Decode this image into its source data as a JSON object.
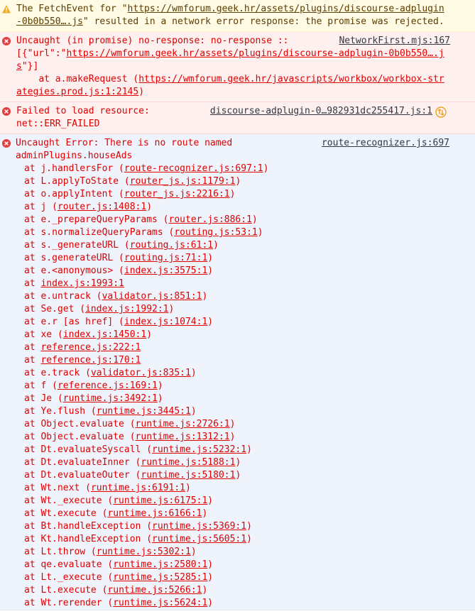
{
  "messages": [
    {
      "type": "warning",
      "icon": "warning-icon",
      "prefix": "The FetchEvent for \"",
      "link": "https://wmforum.geek.hr/assets/plugins/discourse-adplugin-0b0b550….js",
      "suffix": "\" resulted in a network error response: the promise was rejected."
    },
    {
      "type": "error",
      "icon": "error-icon",
      "source": "NetworkFirst.mjs:167",
      "line1": "Uncaught (in promise) no-response: no-response :: ",
      "line2_prefix": "[{\"url\":\"",
      "line2_link": "https://wmforum.geek.hr/assets/plugins/discourse-adplugin-0b0b550….js",
      "line2_suffix": "\"}]",
      "line3_prefix": "    at a.makeRequest (",
      "line3_link": "https://wmforum.geek.hr/javascripts/workbox/workbox-strategies.prod.js:1:2145",
      "line3_suffix": ")"
    },
    {
      "type": "error",
      "icon": "error-icon",
      "source": "discourse-adplugin-0…982931dc255417.js:1",
      "line1": "Failed to load resource:",
      "line2": "net::ERR_FAILED"
    },
    {
      "type": "error-trace",
      "icon": "error-icon",
      "source": "route-recognizer.js:697",
      "line1": "Uncaught Error: There is no route named",
      "line2": "adminPlugins.houseAds"
    }
  ],
  "trace": [
    [
      "j.handlersFor",
      "route-recognizer.js:697:1"
    ],
    [
      "L.applyToState",
      "router_js.js:1179:1"
    ],
    [
      "o.applyIntent",
      "router_js.js:2216:1"
    ],
    [
      "j",
      "router.js:1408:1"
    ],
    [
      "e._prepareQueryParams",
      "router.js:886:1"
    ],
    [
      "s.normalizeQueryParams",
      "routing.js:53:1"
    ],
    [
      "s._generateURL",
      "routing.js:61:1"
    ],
    [
      "s.generateURL",
      "routing.js:71:1"
    ],
    [
      "e.<anonymous>",
      "index.js:3575:1"
    ],
    [
      "",
      "index.js:1993:1"
    ],
    [
      "e.untrack",
      "validator.js:851:1"
    ],
    [
      "Se.get",
      "index.js:1992:1"
    ],
    [
      "e.r [as href]",
      "index.js:1074:1"
    ],
    [
      "xe",
      "index.js:1450:1"
    ],
    [
      "",
      "reference.js:222:1"
    ],
    [
      "",
      "reference.js:170:1"
    ],
    [
      "e.track",
      "validator.js:835:1"
    ],
    [
      "f",
      "reference.js:169:1"
    ],
    [
      "Je",
      "runtime.js:3492:1"
    ],
    [
      "Ye.flush",
      "runtime.js:3445:1"
    ],
    [
      "Object.evaluate",
      "runtime.js:2726:1"
    ],
    [
      "Object.evaluate",
      "runtime.js:1312:1"
    ],
    [
      "Dt.evaluateSyscall",
      "runtime.js:5232:1"
    ],
    [
      "Dt.evaluateInner",
      "runtime.js:5188:1"
    ],
    [
      "Dt.evaluateOuter",
      "runtime.js:5180:1"
    ],
    [
      "Wt.next",
      "runtime.js:6191:1"
    ],
    [
      "Wt._execute",
      "runtime.js:6175:1"
    ],
    [
      "Wt.execute",
      "runtime.js:6166:1"
    ],
    [
      "Bt.handleException",
      "runtime.js:5369:1"
    ],
    [
      "Kt.handleException",
      "runtime.js:5605:1"
    ],
    [
      "Lt.throw",
      "runtime.js:5302:1"
    ],
    [
      "qe.evaluate",
      "runtime.js:2580:1"
    ],
    [
      "Lt._execute",
      "runtime.js:5285:1"
    ],
    [
      "Lt.execute",
      "runtime.js:5266:1"
    ],
    [
      "Wt.rerender",
      "runtime.js:5624:1"
    ]
  ]
}
